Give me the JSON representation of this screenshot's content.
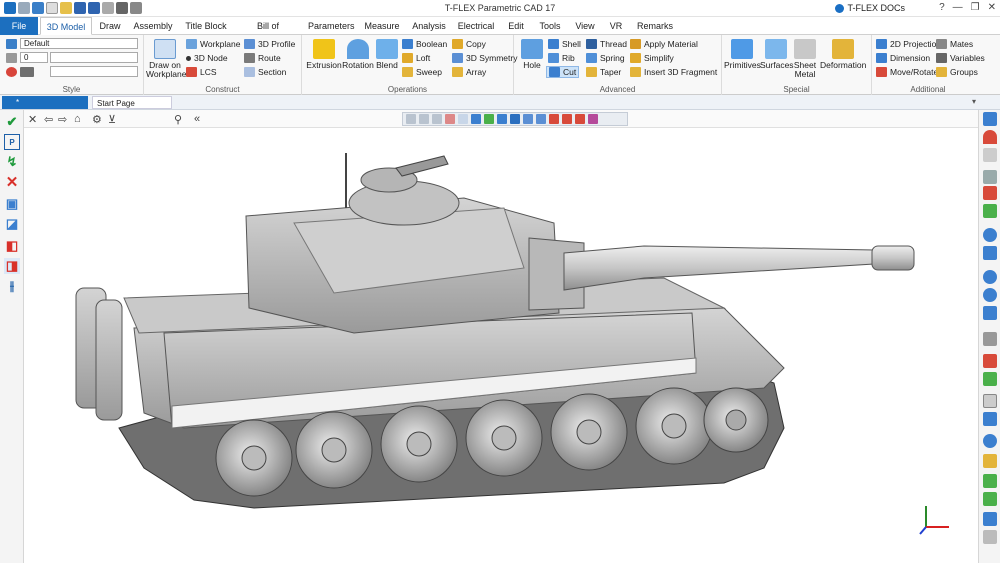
{
  "app": {
    "title": "T-FLEX Parametric CAD 17",
    "docs_label": "T-FLEX DOCs"
  },
  "window_controls": [
    "?",
    "—",
    "❐",
    "✕"
  ],
  "menu": [
    {
      "label": "File"
    },
    {
      "label": "3D Model"
    },
    {
      "label": "Draw"
    },
    {
      "label": "Assembly"
    },
    {
      "label": "Title Block"
    },
    {
      "label": "Bill of Materials"
    },
    {
      "label": "Parameters"
    },
    {
      "label": "Measure"
    },
    {
      "label": "Analysis"
    },
    {
      "label": "Electrical"
    },
    {
      "label": "Edit"
    },
    {
      "label": "Tools"
    },
    {
      "label": "View"
    },
    {
      "label": "VR"
    },
    {
      "label": "Remarks"
    }
  ],
  "ribbon": {
    "style": {
      "label": "Style",
      "style_value": "Default",
      "layer_value": "0"
    },
    "construct": {
      "label": "Construct",
      "draw_on_workplane": "Draw on Workplane",
      "workplane": "Workplane",
      "node_3d": "3D Node",
      "lcs": "LCS",
      "profile_3d": "3D Profile",
      "route": "Route",
      "section": "Section"
    },
    "operations": {
      "label": "Operations",
      "extrusion": "Extrusion",
      "rotation": "Rotation",
      "blend": "Blend",
      "boolean": "Boolean",
      "loft": "Loft",
      "sweep": "Sweep",
      "copy": "Copy",
      "symmetry_3d": "3D Symmetry",
      "array": "Array"
    },
    "advanced": {
      "label": "Advanced",
      "hole": "Hole",
      "shell": "Shell",
      "rib": "Rib",
      "cut": "Cut",
      "thread": "Thread",
      "spring": "Spring",
      "taper": "Taper",
      "apply_material": "Apply Material",
      "simplify": "Simplify",
      "insert_fragment": "Insert 3D Fragment"
    },
    "special": {
      "label": "Special",
      "primitives": "Primitives",
      "surfaces": "Surfaces",
      "sheet_metal": "Sheet Metal",
      "deformation": "Deformation"
    },
    "additional": {
      "label": "Additional",
      "projection_2d": "2D Projection",
      "dimension": "Dimension",
      "move_rotate": "Move/Rotate",
      "mates": "Mates",
      "variables": "Variables",
      "groups": "Groups"
    }
  },
  "documents": {
    "active": "*",
    "start_page": "Start Page"
  },
  "colors": {
    "file_tab": "#1c6fbf",
    "accent": "#1c5fa8",
    "model": "#bdbdbd"
  }
}
